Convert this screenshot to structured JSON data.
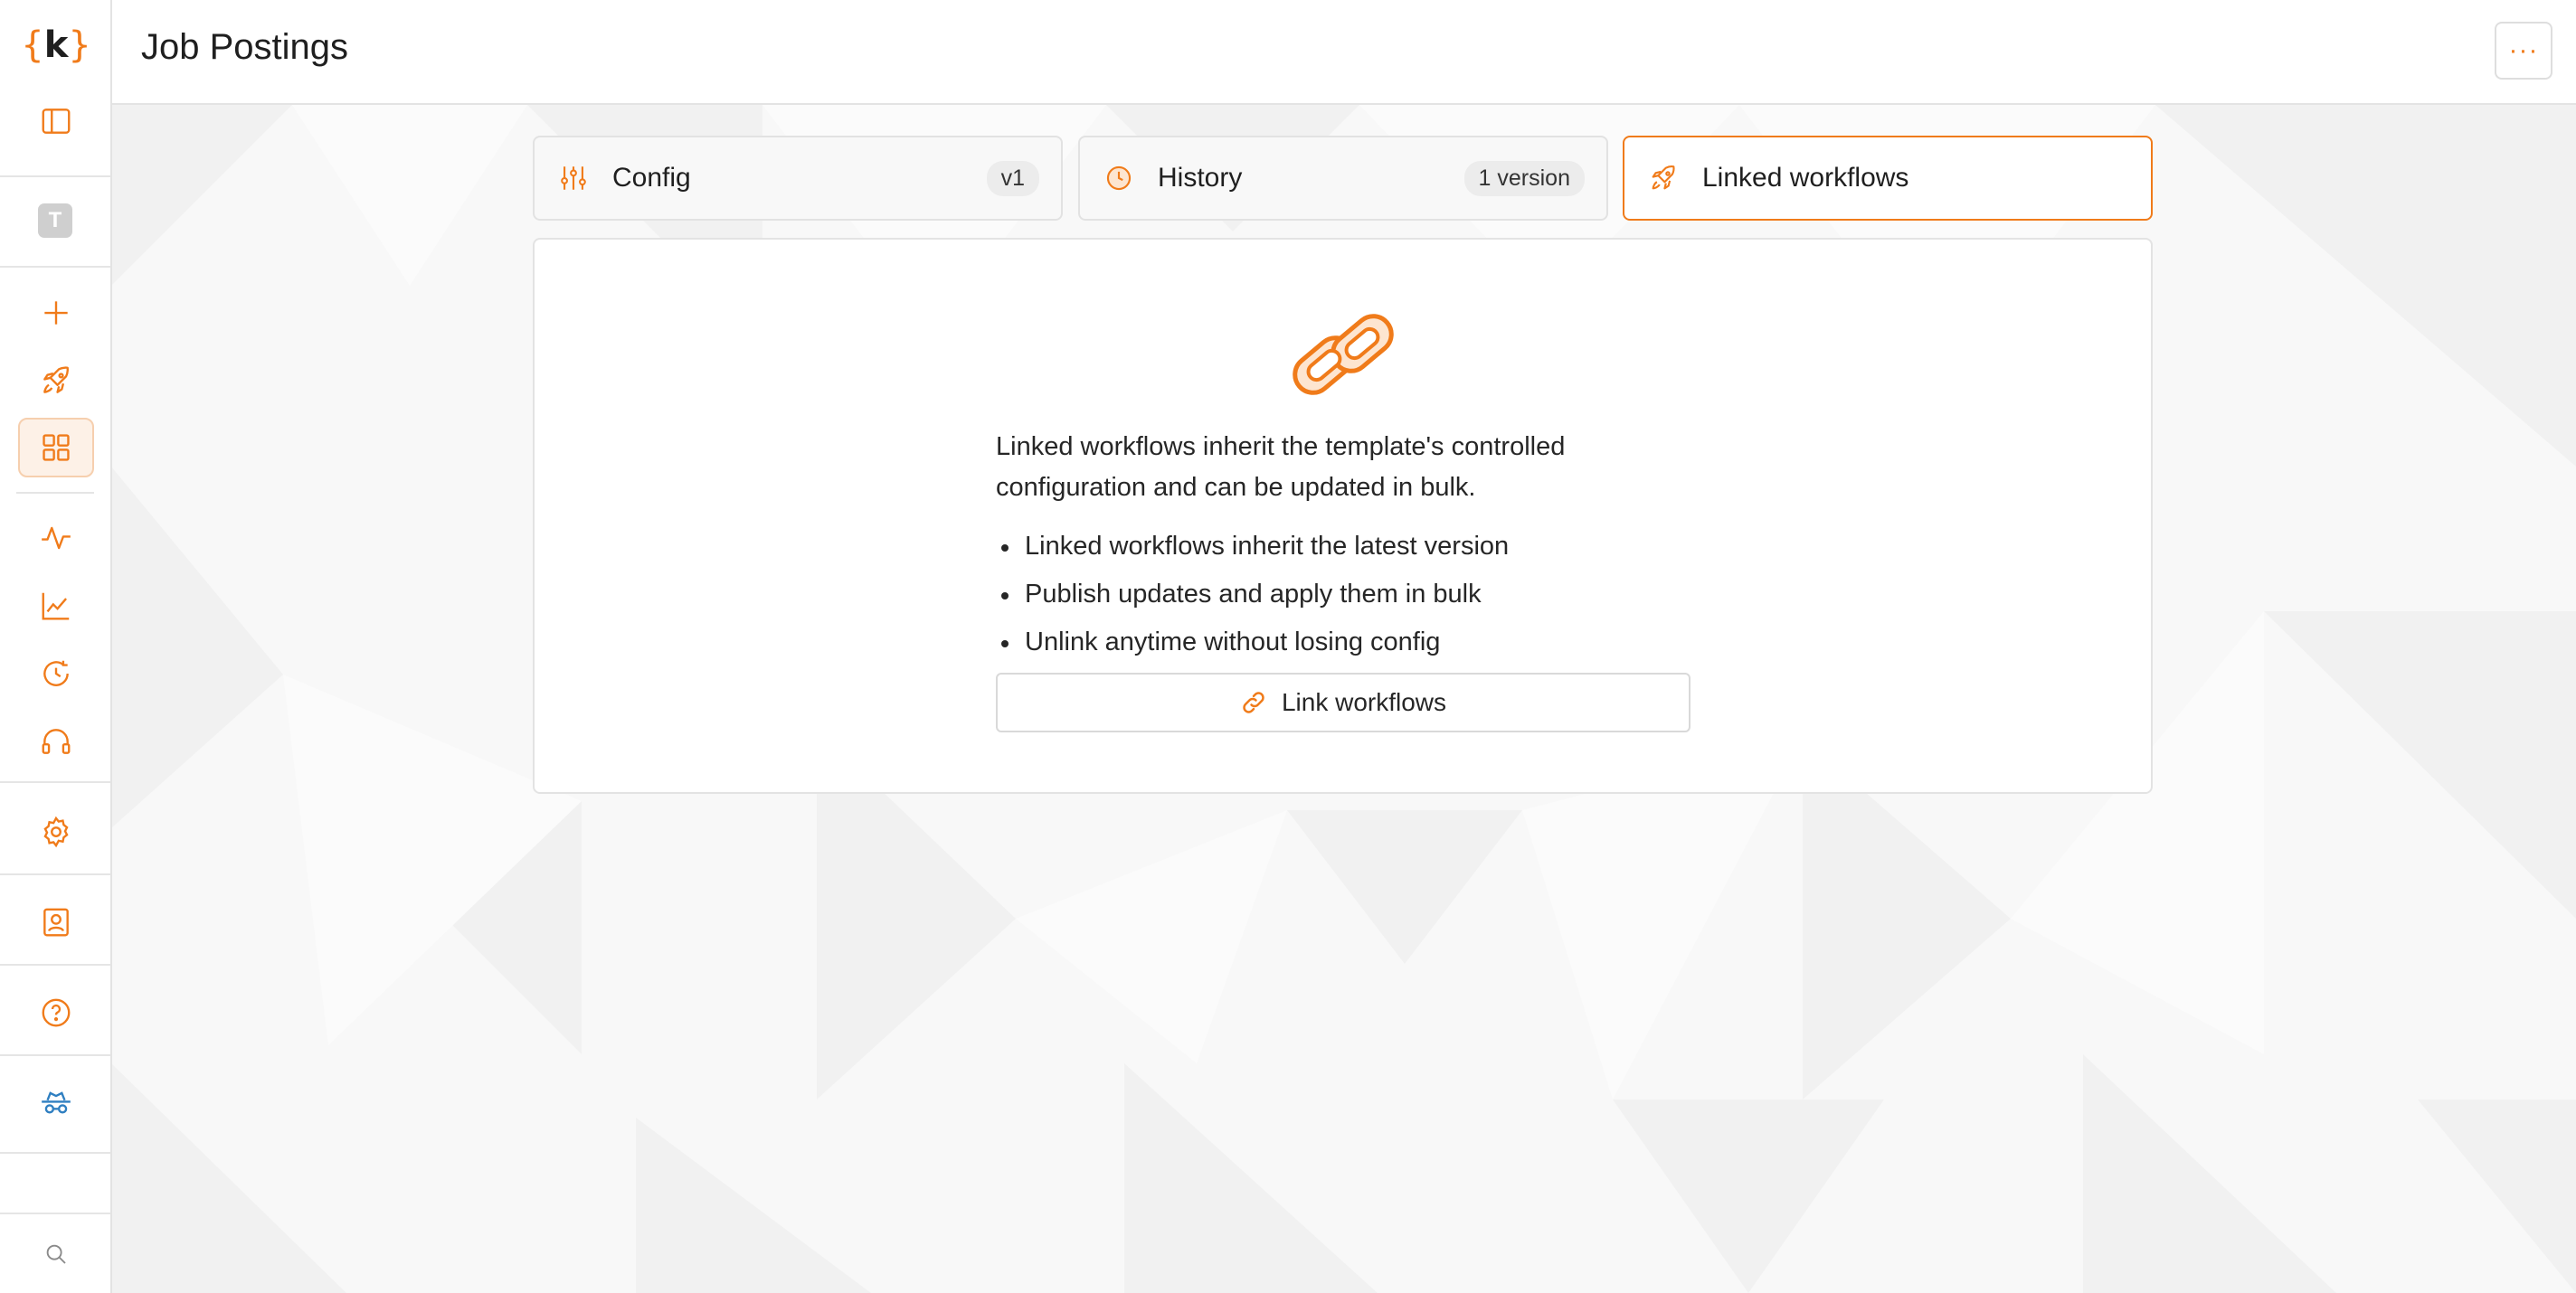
{
  "app": {
    "logo_text": "k",
    "logo_brackets": [
      "{",
      "}"
    ]
  },
  "header": {
    "title": "Job Postings",
    "more_label": "···"
  },
  "sidebar": {
    "avatar_letter": "T",
    "items": [
      {
        "name": "toggle-sidebar",
        "icon": "sidebar-panel-icon"
      },
      {
        "name": "new",
        "icon": "plus-icon"
      },
      {
        "name": "workflows",
        "icon": "rocket-icon"
      },
      {
        "name": "templates",
        "icon": "grid-icon",
        "active": true
      },
      {
        "name": "activity",
        "icon": "pulse-icon"
      },
      {
        "name": "analytics",
        "icon": "line-chart-icon"
      },
      {
        "name": "history",
        "icon": "clock-refresh-icon"
      },
      {
        "name": "support",
        "icon": "headset-icon"
      },
      {
        "name": "settings",
        "icon": "gear-icon"
      },
      {
        "name": "contacts",
        "icon": "contact-card-icon"
      },
      {
        "name": "help",
        "icon": "question-circle-icon"
      },
      {
        "name": "incognito",
        "icon": "spy-hat-icon"
      },
      {
        "name": "search",
        "icon": "search-icon"
      }
    ]
  },
  "tabs": [
    {
      "label": "Config",
      "badge": "v1",
      "icon": "sliders-icon"
    },
    {
      "label": "History",
      "badge": "1 version",
      "icon": "clock-icon"
    },
    {
      "label": "Linked workflows",
      "icon": "rocket-icon",
      "active": true
    }
  ],
  "linked": {
    "description": "Linked workflows inherit the template's controlled configuration and can be updated in bulk.",
    "bullets": [
      "Linked workflows inherit the latest version",
      "Publish updates and apply them in bulk",
      "Unlink anytime without losing config"
    ],
    "button_label": "Link workflows",
    "icon": "chain-link-icon"
  },
  "colors": {
    "accent": "#f07b1a",
    "accent_soft": "#fde5d0",
    "border": "#e3e3e3"
  }
}
